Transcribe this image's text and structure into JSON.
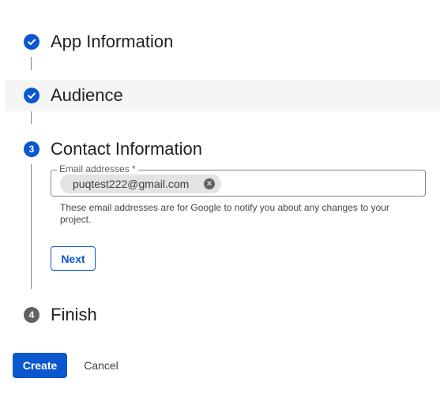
{
  "steps": [
    {
      "number": "",
      "title": "App Information",
      "status": "done"
    },
    {
      "number": "",
      "title": "Audience",
      "status": "done"
    },
    {
      "number": "3",
      "title": "Contact Information",
      "status": "active"
    },
    {
      "number": "4",
      "title": "Finish",
      "status": "pending"
    }
  ],
  "contact": {
    "field_label": "Email addresses *",
    "chip_value": "puqtest222@gmail.com",
    "chip_remove_icon": "cancel-circle-icon",
    "helper_text": "These email addresses are for Google to notify you about any changes to your project.",
    "next_label": "Next"
  },
  "actions": {
    "create_label": "Create",
    "cancel_label": "Cancel"
  },
  "colors": {
    "accent": "#0b57d0",
    "pending": "#5f6368",
    "highlight_bg": "#f4f5f4"
  }
}
